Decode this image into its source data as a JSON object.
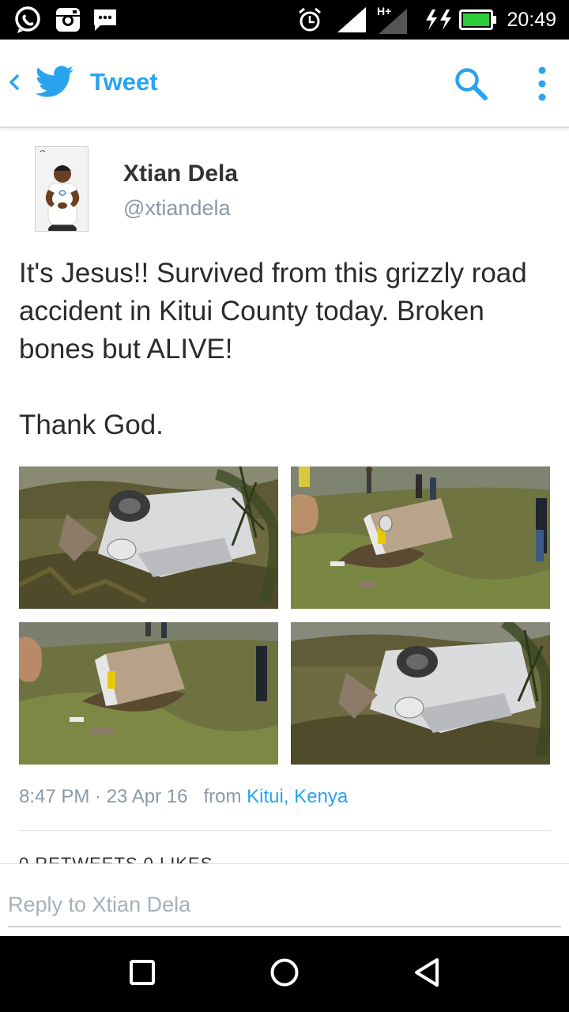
{
  "status_bar": {
    "time": "20:49",
    "network_label": "H+",
    "icons": [
      "whatsapp-icon",
      "instagram-icon",
      "messaging-icon",
      "alarm-icon",
      "signal-icon",
      "signal-hplus-icon",
      "charging-icon",
      "battery-icon"
    ]
  },
  "app_bar": {
    "title": "Tweet",
    "icons": [
      "back-chevron-icon",
      "twitter-bird-icon",
      "search-icon",
      "more-vertical-icon"
    ]
  },
  "tweet": {
    "author_name": "Xtian Dela",
    "author_handle": "@xtiandela",
    "text_lines": [
      "It's Jesus!! Survived from this grizzly road accident in Kitui County today. Broken bones but ALIVE!",
      "Thank God."
    ],
    "photos_count": 4,
    "timestamp": "8:47 PM · 23 Apr 16",
    "from_label": "from",
    "location": "Kitui, Kenya",
    "stats_peek": "0 RETWEETS   0 LIKES"
  },
  "reply": {
    "placeholder": "Reply to Xtian Dela"
  },
  "nav_bar": {
    "icons": [
      "recent-apps-icon",
      "home-icon",
      "back-icon"
    ]
  },
  "colors": {
    "accent": "#2aa3ef",
    "muted": "#8b99a6",
    "text": "#2b2b2b"
  }
}
